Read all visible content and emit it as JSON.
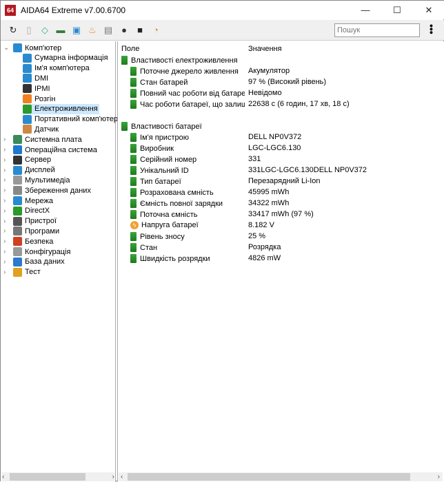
{
  "window": {
    "logo": "64",
    "title": "AIDA64 Extreme v7.00.6700",
    "minimize": "—",
    "maximize": "☐",
    "close": "✕"
  },
  "toolbar": {
    "icons": [
      "refresh-icon",
      "report-icon",
      "motherboard-icon",
      "memory-icon",
      "network-icon",
      "flame-icon",
      "clipboard-icon",
      "user-icon",
      "osd-icon",
      "gauge-icon"
    ],
    "search_placeholder": "Пошук",
    "more": "⋮"
  },
  "tree": {
    "root": "Комп'ютер",
    "children": [
      "Сумарна інформація",
      "Ім'я комп'ютера",
      "DMI",
      "IPMI",
      "Розгін",
      "Електроживлення",
      "Портативний комп'ютер",
      "Датчик"
    ],
    "selected": "Електроживлення",
    "groups": [
      "Системна плата",
      "Операційна система",
      "Сервер",
      "Дисплей",
      "Мультимедіа",
      "Збереження даних",
      "Мережа",
      "DirectX",
      "Пристрої",
      "Програми",
      "Безпека",
      "Конфігурація",
      "База даних",
      "Тест"
    ]
  },
  "table": {
    "col_field": "Поле",
    "col_value": "Значення",
    "sections": [
      {
        "title": "Властивості електроживлення",
        "rows": [
          {
            "field": "Поточне джерело живлення",
            "value": "Акумулятор"
          },
          {
            "field": "Стан батарей",
            "value": "97 % (Високий рівень)"
          },
          {
            "field": "Повний час роботи від батареї",
            "value": "Невідомо"
          },
          {
            "field": "Час роботи батареї, що залиш...",
            "value": "22638 с (6 годин, 17 хв, 18 с)"
          }
        ]
      },
      {
        "title": "Властивості батареї",
        "rows": [
          {
            "field": "Ім'я пристрою",
            "value": "DELL NP0V372"
          },
          {
            "field": "Виробник",
            "value": "LGC-LGC6.130"
          },
          {
            "field": "Серійний номер",
            "value": "331"
          },
          {
            "field": "Унікальний ID",
            "value": "331LGC-LGC6.130DELL NP0V372"
          },
          {
            "field": "Тип батареї",
            "value": "Перезарядний Li-Ion"
          },
          {
            "field": "Розрахована ємність",
            "value": "45995 mWh"
          },
          {
            "field": "Ємність повної зарядки",
            "value": "34322 mWh"
          },
          {
            "field": "Поточна ємність",
            "value": "33417 mWh  (97 %)"
          },
          {
            "field": "Напруга батареї",
            "value": "8.182 V",
            "icon": "bolt"
          },
          {
            "field": "Рівень зносу",
            "value": "25 %"
          },
          {
            "field": "Стан",
            "value": "Розрядка"
          },
          {
            "field": "Швидкість розрядки",
            "value": "4826 mW"
          }
        ]
      }
    ]
  }
}
